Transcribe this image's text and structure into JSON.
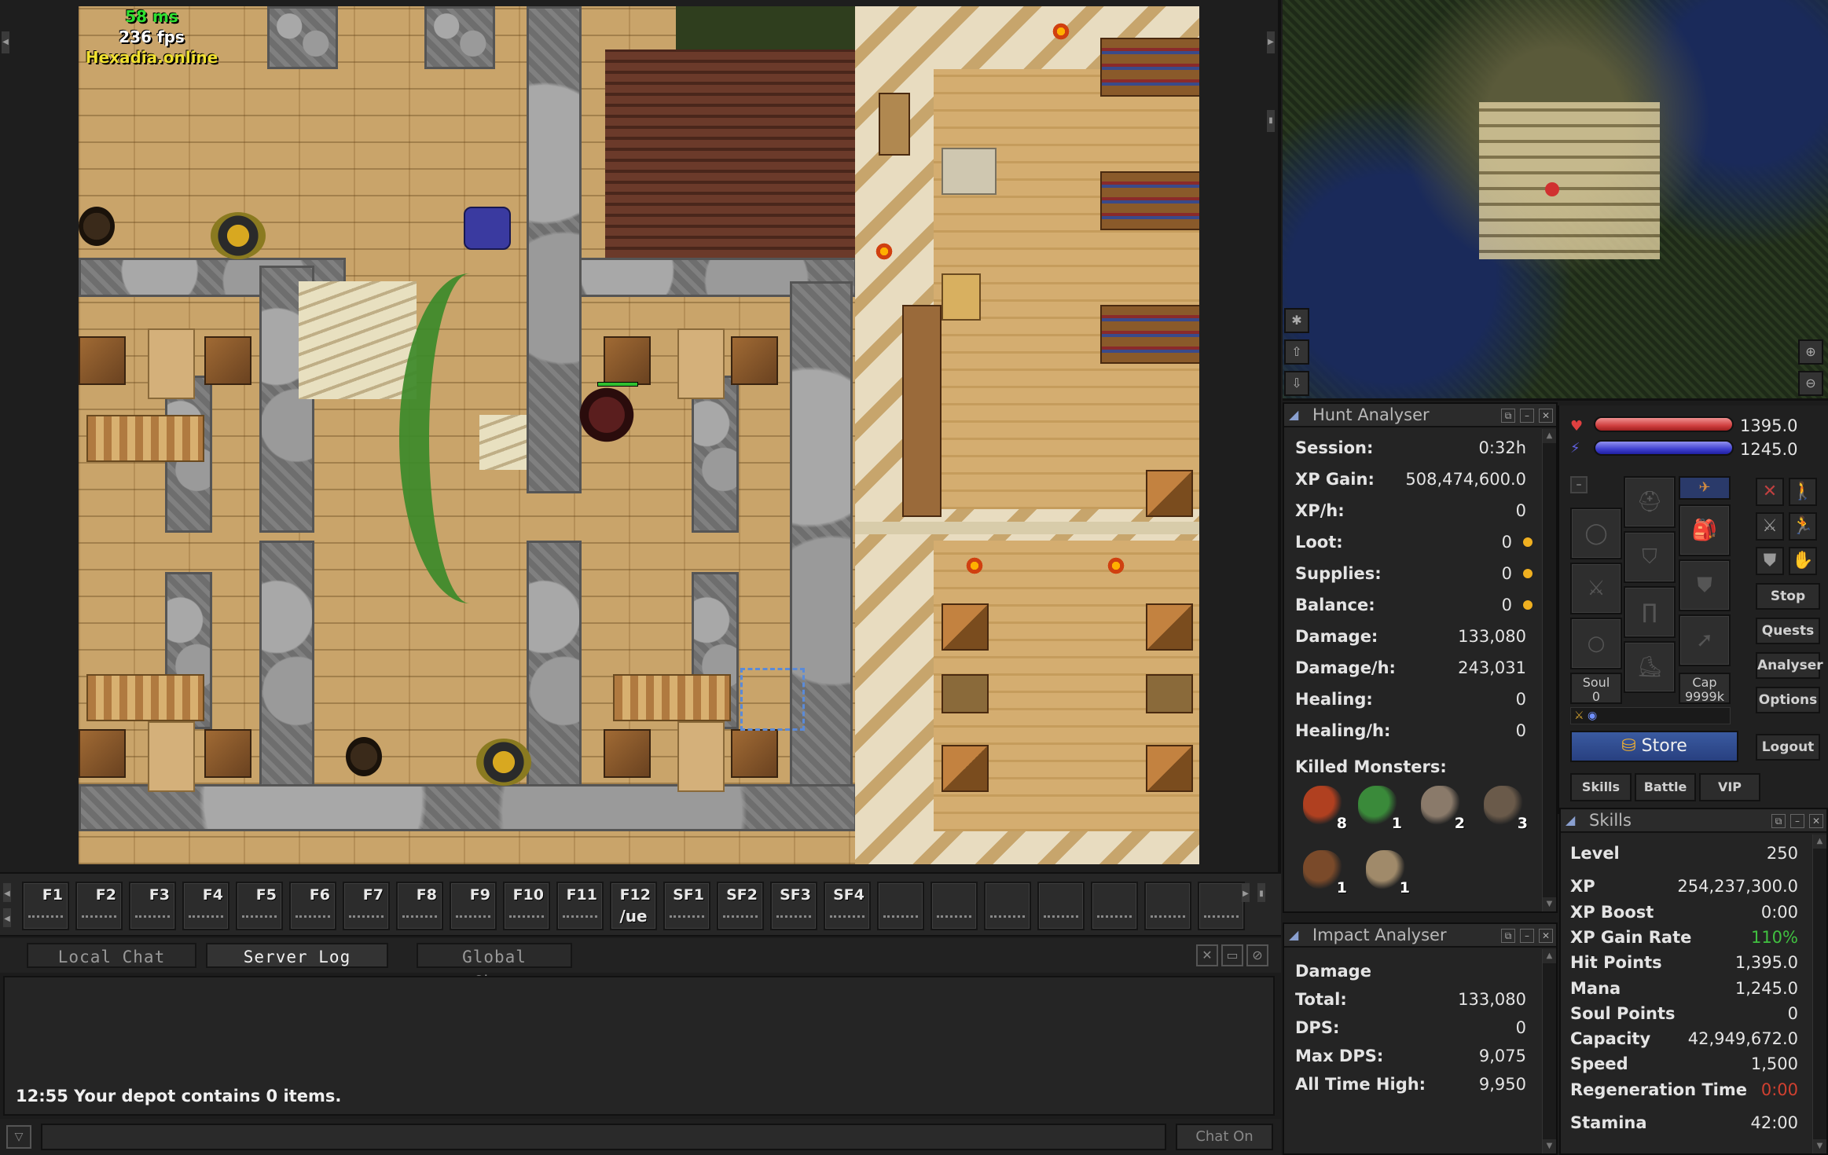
{
  "overlay": {
    "ping": "58 ms",
    "fps": "236 fps",
    "server": "Hexadia.online"
  },
  "hotkeys": [
    {
      "label": "F1",
      "sub": ""
    },
    {
      "label": "F2",
      "sub": ""
    },
    {
      "label": "F3",
      "sub": ""
    },
    {
      "label": "F4",
      "sub": ""
    },
    {
      "label": "F5",
      "sub": ""
    },
    {
      "label": "F6",
      "sub": ""
    },
    {
      "label": "F7",
      "sub": ""
    },
    {
      "label": "F8",
      "sub": ""
    },
    {
      "label": "F9",
      "sub": ""
    },
    {
      "label": "F10",
      "sub": ""
    },
    {
      "label": "F11",
      "sub": ""
    },
    {
      "label": "F12",
      "sub": "/ue"
    },
    {
      "label": "SF1",
      "sub": ""
    },
    {
      "label": "SF2",
      "sub": ""
    },
    {
      "label": "SF3",
      "sub": ""
    },
    {
      "label": "SF4",
      "sub": ""
    }
  ],
  "chat": {
    "tabs": [
      {
        "label": "Local Chat",
        "active": false
      },
      {
        "label": "Server Log",
        "active": true
      },
      {
        "label": "Global Chat",
        "active": false
      }
    ],
    "messages": [
      "12:55 Your depot contains 0 items."
    ],
    "toggle_label": "Chat On"
  },
  "hunt_analyser": {
    "title": "Hunt Analyser",
    "rows": [
      {
        "label": "Session:",
        "value": "0:32h",
        "coin": false
      },
      {
        "label": "XP Gain:",
        "value": "508,474,600.0",
        "coin": false
      },
      {
        "label": "XP/h:",
        "value": "0",
        "coin": false
      },
      {
        "label": "Loot:",
        "value": "0",
        "coin": true
      },
      {
        "label": "Supplies:",
        "value": "0",
        "coin": true
      },
      {
        "label": "Balance:",
        "value": "0",
        "coin": true
      },
      {
        "label": "Damage:",
        "value": "133,080",
        "coin": false
      },
      {
        "label": "Damage/h:",
        "value": "243,031",
        "coin": false
      },
      {
        "label": "Healing:",
        "value": "0",
        "coin": false
      },
      {
        "label": "Healing/h:",
        "value": "0",
        "coin": false
      }
    ],
    "killed_label": "Killed Monsters:",
    "killed": [
      {
        "icon": "demon-icon",
        "count": "8",
        "color": "#b04020"
      },
      {
        "icon": "lizard-icon",
        "count": "1",
        "color": "#3a8a3a"
      },
      {
        "icon": "ghoul-icon",
        "count": "2",
        "color": "#8a7a6a"
      },
      {
        "icon": "rat-icon",
        "count": "3",
        "color": "#6a5a4a"
      },
      {
        "icon": "bat-icon",
        "count": "1",
        "color": "#7a4a2a"
      },
      {
        "icon": "golem-icon",
        "count": "1",
        "color": "#a08a6a"
      }
    ]
  },
  "impact_analyser": {
    "title": "Impact Analyser",
    "section": "Damage",
    "rows": [
      {
        "label": "Total:",
        "value": "133,080"
      },
      {
        "label": "DPS:",
        "value": "0"
      },
      {
        "label": "Max DPS:",
        "value": "9,075"
      },
      {
        "label": "All Time High:",
        "value": "9,950"
      }
    ]
  },
  "status": {
    "hp": "1395.0",
    "mana": "1245.0",
    "soul_label": "Soul",
    "soul": "0",
    "cap_label": "Cap",
    "cap": "9999k"
  },
  "equipment_buttons": {
    "stop": "Stop",
    "quests": "Quests",
    "analyser": "Analyser",
    "options": "Options",
    "store": "Store",
    "logout": "Logout",
    "skills": "Skills",
    "battle": "Battle",
    "vip": "VIP"
  },
  "skills": {
    "title": "Skills",
    "rows": [
      {
        "label": "Level",
        "value": "250",
        "color": "#e4e4e4"
      },
      {
        "label": "XP",
        "value": "254,237,300.0",
        "color": "#e4e4e4"
      },
      {
        "label": "XP Boost",
        "value": "0:00",
        "color": "#e4e4e4"
      },
      {
        "label": "XP Gain Rate",
        "value": "110%",
        "color": "#40c040"
      },
      {
        "label": "Hit Points",
        "value": "1,395.0",
        "color": "#e4e4e4"
      },
      {
        "label": "Mana",
        "value": "1,245.0",
        "color": "#e4e4e4"
      },
      {
        "label": "Soul Points",
        "value": "0",
        "color": "#e4e4e4"
      },
      {
        "label": "Capacity",
        "value": "42,949,672.0",
        "color": "#e4e4e4"
      },
      {
        "label": "Speed",
        "value": "1,500",
        "color": "#e4e4e4"
      },
      {
        "label": "Regeneration Time",
        "value": "0:00",
        "color": "#d04030"
      },
      {
        "label": "Stamina",
        "value": "42:00",
        "color": "#e4e4e4"
      }
    ]
  }
}
